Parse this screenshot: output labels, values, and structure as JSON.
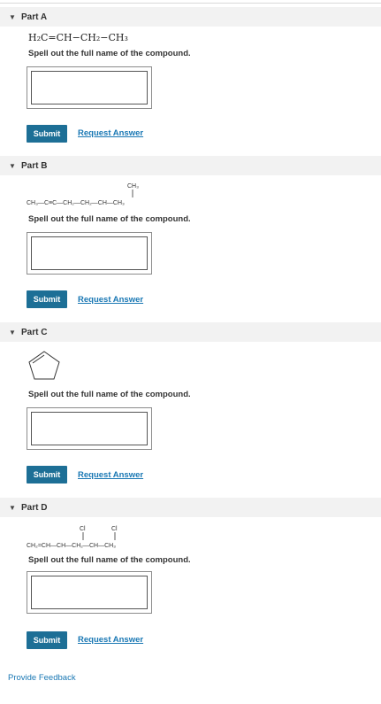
{
  "parts": [
    {
      "title": "Part A",
      "prompt": "Spell out the full name of the compound.",
      "submit": "Submit",
      "request": "Request Answer"
    },
    {
      "title": "Part B",
      "prompt": "Spell out the full name of the compound.",
      "submit": "Submit",
      "request": "Request Answer"
    },
    {
      "title": "Part C",
      "prompt": "Spell out the full name of the compound.",
      "submit": "Submit",
      "request": "Request Answer"
    },
    {
      "title": "Part D",
      "prompt": "Spell out the full name of the compound.",
      "submit": "Submit",
      "request": "Request Answer"
    }
  ],
  "structures": {
    "a": {
      "main": "H₂C=CH−CH₂−CH₃"
    },
    "b": {
      "main": "CH₃—C≡C—CH₂—CH₂—CH—CH₃",
      "branch": "CH₃"
    },
    "d": {
      "main": "CH₂=CH—CH—CH₂—CH—CH₃",
      "branch1": "Cl",
      "branch2": "Cl"
    }
  },
  "footer": {
    "feedback": "Provide Feedback"
  }
}
